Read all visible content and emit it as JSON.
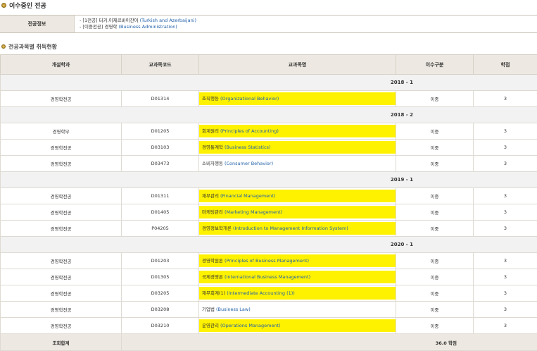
{
  "section_title": "이수중인 전공",
  "major_info": {
    "label": "전공정보",
    "line1": {
      "prefix": "- [1전공] 터키,이제르바이잔어 ",
      "en": "(Turkish and Azerbaijani)"
    },
    "line2": {
      "prefix": "- [이중전공] 경영학 ",
      "en": "(Business Administration)"
    }
  },
  "sub_section_title": "전공과목별 취득현황",
  "table": {
    "headers": [
      "개설학과",
      "교과목코드",
      "교과목명",
      "이수구분",
      "학점"
    ],
    "groups": [
      {
        "term": "2018 - 1",
        "rows": [
          {
            "dept": "경영학전공",
            "code": "D01314",
            "ko": "조직행동 ",
            "en": "(Organizational Behavior)",
            "highlight": true,
            "type": "이중",
            "credit": "3"
          }
        ]
      },
      {
        "term": "2018 - 2",
        "rows": [
          {
            "dept": "경영학부",
            "code": "D01205",
            "ko": "회계원리 ",
            "en": "(Principles of Accounting)",
            "highlight": true,
            "type": "이중",
            "credit": "3"
          },
          {
            "dept": "경영학전공",
            "code": "D03103",
            "ko": "경영통계학 ",
            "en": "(Business Statistics)",
            "highlight": true,
            "type": "이중",
            "credit": "3"
          },
          {
            "dept": "경영학전공",
            "code": "D03473",
            "ko": "소비자행동 ",
            "en": "(Consumer Behavior)",
            "highlight": false,
            "type": "이중",
            "credit": "3"
          }
        ]
      },
      {
        "term": "2019 - 1",
        "rows": [
          {
            "dept": "경영학전공",
            "code": "D01311",
            "ko": "재무관리 ",
            "en": "(Financial Management)",
            "highlight": true,
            "type": "이중",
            "credit": "3"
          },
          {
            "dept": "경영학전공",
            "code": "D01405",
            "ko": "마케팅관리 ",
            "en": "(Marketing Management)",
            "highlight": true,
            "type": "이중",
            "credit": "3"
          },
          {
            "dept": "경영학전공",
            "code": "P04205",
            "ko": "경영정보학개론 ",
            "en": "(Introduction to Management Information System)",
            "highlight": true,
            "type": "이중",
            "credit": "3"
          }
        ]
      },
      {
        "term": "2020 - 1",
        "rows": [
          {
            "dept": "경영학전공",
            "code": "D01203",
            "ko": "경영학원론 ",
            "en": "(Principles of Business Management)",
            "highlight": true,
            "type": "이중",
            "credit": "3"
          },
          {
            "dept": "경영학전공",
            "code": "D01305",
            "ko": "국제경영론 ",
            "en": "(International Business Management)",
            "highlight": true,
            "type": "이중",
            "credit": "3"
          },
          {
            "dept": "경영학전공",
            "code": "D03205",
            "ko": "재무회계(1) ",
            "en": "(Intermediate Accounting (1))",
            "highlight": true,
            "type": "이중",
            "credit": "3"
          },
          {
            "dept": "경영학전공",
            "code": "D03208",
            "ko": "기업법 ",
            "en": "(Business Law)",
            "highlight": false,
            "type": "이중",
            "credit": "3"
          },
          {
            "dept": "경영학전공",
            "code": "D03210",
            "ko": "운영관리 ",
            "en": "(Operations Management)",
            "highlight": true,
            "type": "이중",
            "credit": "3"
          }
        ]
      }
    ],
    "total": {
      "label": "조회합계",
      "value": "36.0 학점"
    }
  },
  "colors": {
    "highlight": "#fff200",
    "english_text": "#1f5fa8",
    "header_bg": "#ede8e1"
  }
}
